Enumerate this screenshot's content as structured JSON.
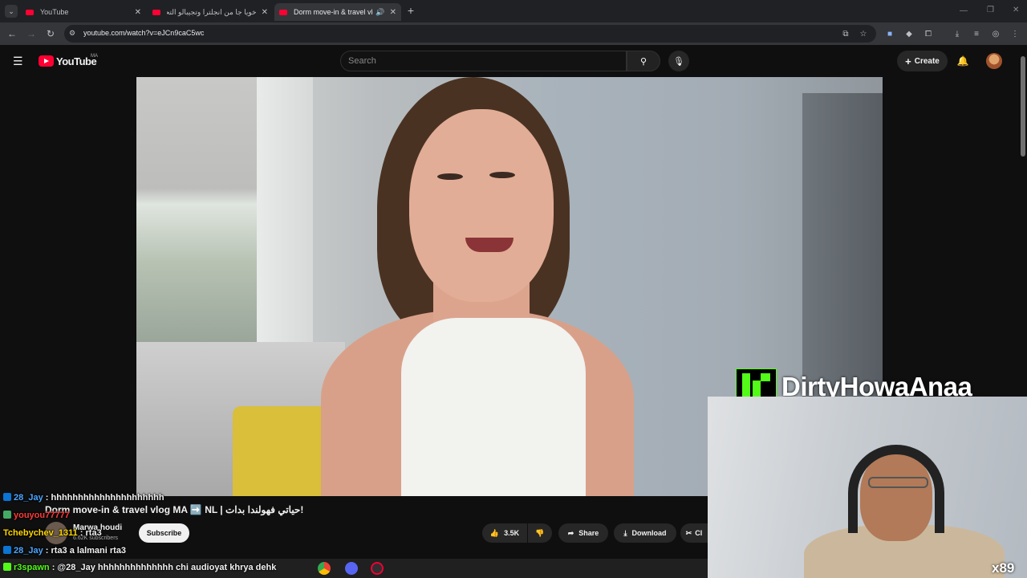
{
  "browser": {
    "tabs": [
      {
        "title": "YouTube",
        "active": false
      },
      {
        "title": "خويا جا من انجلترا وتجيبالو التحيلة",
        "active": false
      },
      {
        "title": "Dorm move-in & travel vlo",
        "active": true
      }
    ],
    "url": "youtube.com/watch?v=eJCn9caC5wc",
    "new_tab": "+"
  },
  "youtube": {
    "logo_text": "YouTube",
    "country": "MA",
    "search_placeholder": "Search",
    "create_label": "Create"
  },
  "video": {
    "title": "Dorm move-in & travel vlog MA ➡️ NL | حياتي فهولندا بدات!",
    "channel": "Marwa houdi",
    "subscribers": "6.62K subscribers",
    "subscribe_label": "Subscribe",
    "likes": "3.5K",
    "share_label": "Share",
    "download_label": "Download",
    "clip_label": "Cl"
  },
  "stream": {
    "name": "DirtyHowaAnaa",
    "combo": "x89"
  },
  "chat": [
    {
      "user": "28_Jay",
      "message": "hhhhhhhhhhhhhhhhhhhhh",
      "color": "#4da6ff"
    },
    {
      "user": "youyou77777",
      "message": "",
      "color": "#ff3b3b"
    },
    {
      "user": "Tchebychev_1311",
      "message": "rta3",
      "color": "#ffd700"
    },
    {
      "user": "28_Jay",
      "message": "rta3 a lalmani rta3",
      "color": "#4da6ff"
    },
    {
      "user": "r3spawn",
      "message": "@28_Jay hhhhhhhhhhhhhh chi audioyat khrya dehk",
      "color": "#53fc18"
    }
  ],
  "colors": {
    "youtube_red": "#ff0033",
    "kick_green": "#53fc18",
    "background": "#0f0f0f"
  }
}
